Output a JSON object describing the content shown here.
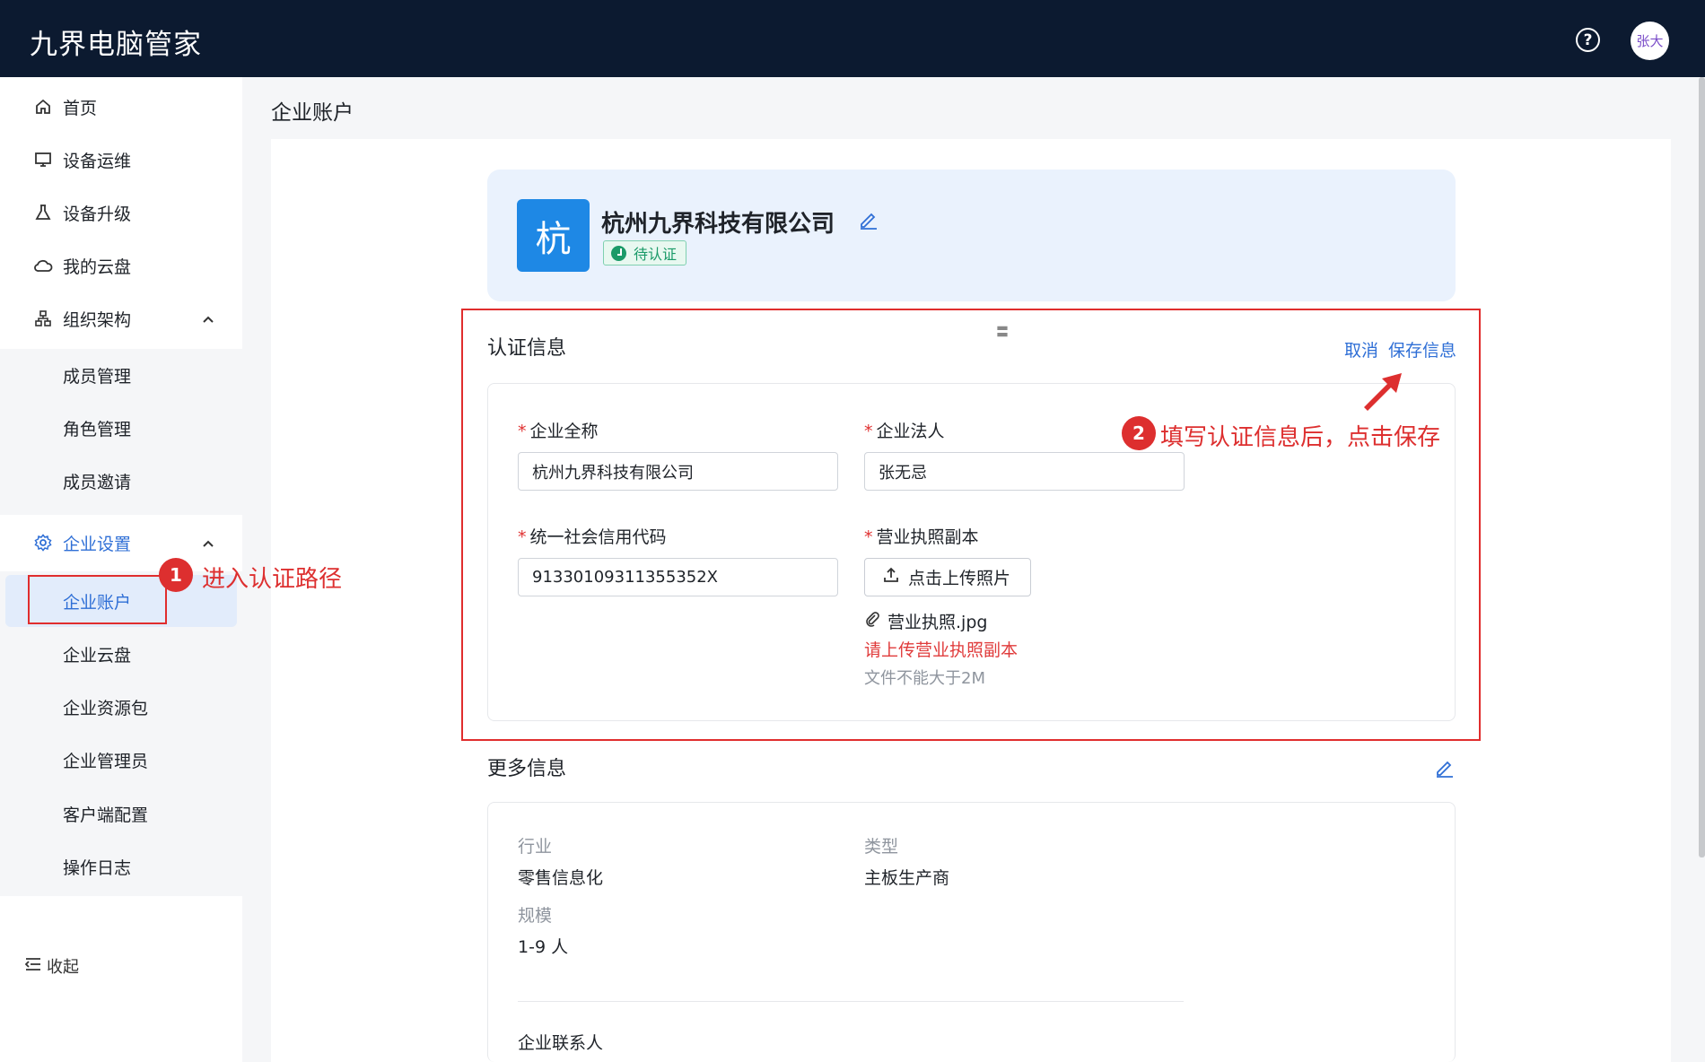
{
  "topbar": {
    "app_title": "九界电脑管家",
    "help_icon": "help-circle-icon",
    "user_avatar_text": "张大"
  },
  "sidebar": {
    "items": [
      {
        "label": "首页",
        "icon": "home-icon"
      },
      {
        "label": "设备运维",
        "icon": "monitor-icon"
      },
      {
        "label": "设备升级",
        "icon": "flask-icon"
      },
      {
        "label": "我的云盘",
        "icon": "cloud-icon"
      },
      {
        "label": "组织架构",
        "icon": "org-chart-icon"
      }
    ],
    "org_sub": [
      "成员管理",
      "角色管理",
      "成员邀请"
    ],
    "settings": {
      "label": "企业设置",
      "icon": "gear-icon"
    },
    "settings_sub": [
      "企业账户",
      "企业云盘",
      "企业资源包",
      "企业管理员",
      "客户端配置",
      "操作日志"
    ],
    "collapse_label": "收起"
  },
  "page": {
    "title": "企业账户"
  },
  "company": {
    "logo_char": "杭",
    "name": "杭州九界科技有限公司",
    "status": "待认证"
  },
  "cert": {
    "title": "认证信息",
    "drag_glyph": "〓",
    "cancel_label": "取消",
    "save_label": "保存信息",
    "full_name_label": "企业全称",
    "full_name_value": "杭州九界科技有限公司",
    "legal_label": "企业法人",
    "legal_value": "张无忌",
    "credit_label": "统一社会信用代码",
    "credit_value": "91330109311355352X",
    "license_label": "营业执照副本",
    "upload_label": "点击上传照片",
    "file_name": "营业执照.jpg",
    "error_text": "请上传营业执照副本",
    "hint_text": "文件不能大于2M"
  },
  "more": {
    "title": "更多信息",
    "industry_label": "行业",
    "industry_value": "零售信息化",
    "type_label": "类型",
    "type_value": "主板生产商",
    "scale_label": "规模",
    "scale_value": "1-9 人",
    "contact_label": "企业联系人"
  },
  "annotations": {
    "step1_num": "1",
    "step1_text": "进入认证路径",
    "step2_num": "2",
    "step2_text": "填写认证信息后，点击保存"
  },
  "colors": {
    "accent": "#2f6fd6",
    "topbar": "#0c1a30",
    "annotation": "#dd2f2f",
    "logo": "#1e88e5"
  }
}
